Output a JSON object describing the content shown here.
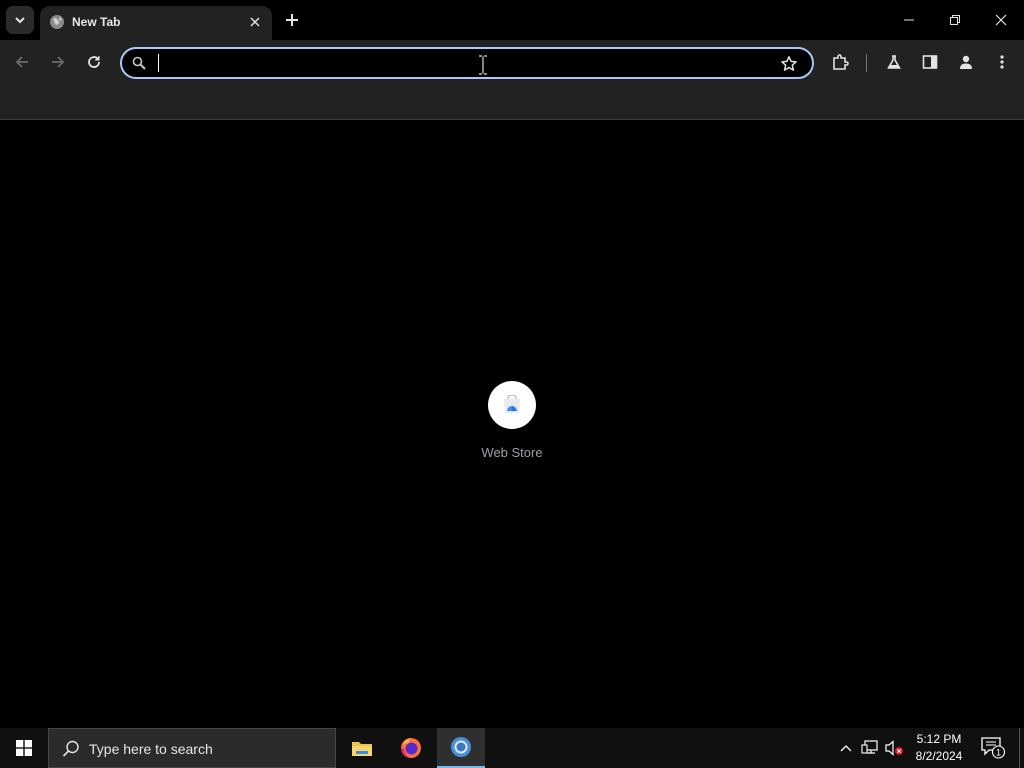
{
  "browser": {
    "tab": {
      "title": "New Tab"
    },
    "omnibox": {
      "value": "",
      "placeholder": ""
    }
  },
  "content": {
    "shortcuts": [
      {
        "label": "Web Store"
      }
    ]
  },
  "taskbar": {
    "search_placeholder": "Type here to search",
    "apps": [
      "file-explorer",
      "firefox",
      "chrome"
    ],
    "clock": {
      "time": "5:12 PM",
      "date": "8/2/2024"
    },
    "notification_count": "1"
  },
  "colors": {
    "omnibox_border": "#a8c7fa",
    "toolbar_bg": "#222222",
    "taskbar_active": "#76b9ed"
  }
}
